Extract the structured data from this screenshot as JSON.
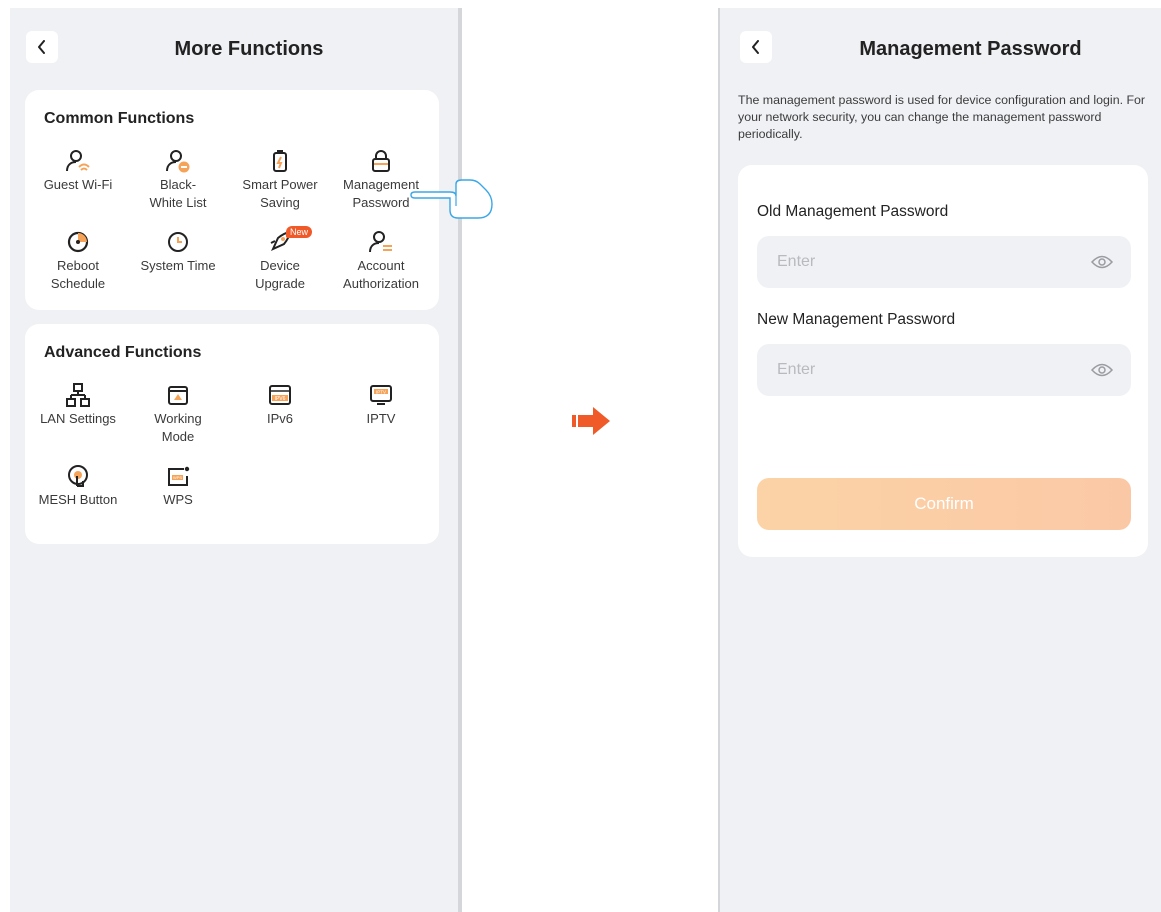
{
  "left_screen": {
    "title": "More Functions",
    "common": {
      "heading": "Common Functions",
      "items": [
        {
          "label": "Guest Wi-Fi",
          "icon": "guest-wifi-icon"
        },
        {
          "label": "Black-\nWhite List",
          "icon": "black-white-list-icon"
        },
        {
          "label": "Smart Power\nSaving",
          "icon": "power-saving-icon"
        },
        {
          "label": "Management\nPassword",
          "icon": "lock-icon"
        },
        {
          "label": "Reboot\nSchedule",
          "icon": "reboot-schedule-icon"
        },
        {
          "label": "System Time",
          "icon": "clock-icon"
        },
        {
          "label": "Device\nUpgrade",
          "icon": "rocket-icon",
          "badge": "New"
        },
        {
          "label": "Account\nAuthorization",
          "icon": "account-authorization-icon"
        }
      ]
    },
    "advanced": {
      "heading": "Advanced Functions",
      "items": [
        {
          "label": "LAN Settings",
          "icon": "lan-icon"
        },
        {
          "label": "Working\nMode",
          "icon": "working-mode-icon"
        },
        {
          "label": "IPv6",
          "icon": "ipv6-icon",
          "icon_text": "IPV6"
        },
        {
          "label": "IPTV",
          "icon": "iptv-icon",
          "icon_text": "IPTV"
        },
        {
          "label": "MESH Button",
          "icon": "mesh-button-icon"
        },
        {
          "label": "WPS",
          "icon": "wps-icon",
          "icon_text": "WPS"
        }
      ]
    }
  },
  "right_screen": {
    "title": "Management Password",
    "description": "The management password is used for device configuration and login. For your network security, you can change the management password periodically.",
    "old_password": {
      "label": "Old Management Password",
      "placeholder": "Enter"
    },
    "new_password": {
      "label": "New Management Password",
      "placeholder": "Enter"
    },
    "confirm_label": "Confirm"
  },
  "colors": {
    "accent": "#f05a28",
    "icon_orange": "#f6a35a",
    "background": "#f0f1f5",
    "confirm_start": "#fbd3a6",
    "confirm_end": "#fbc8a6"
  }
}
